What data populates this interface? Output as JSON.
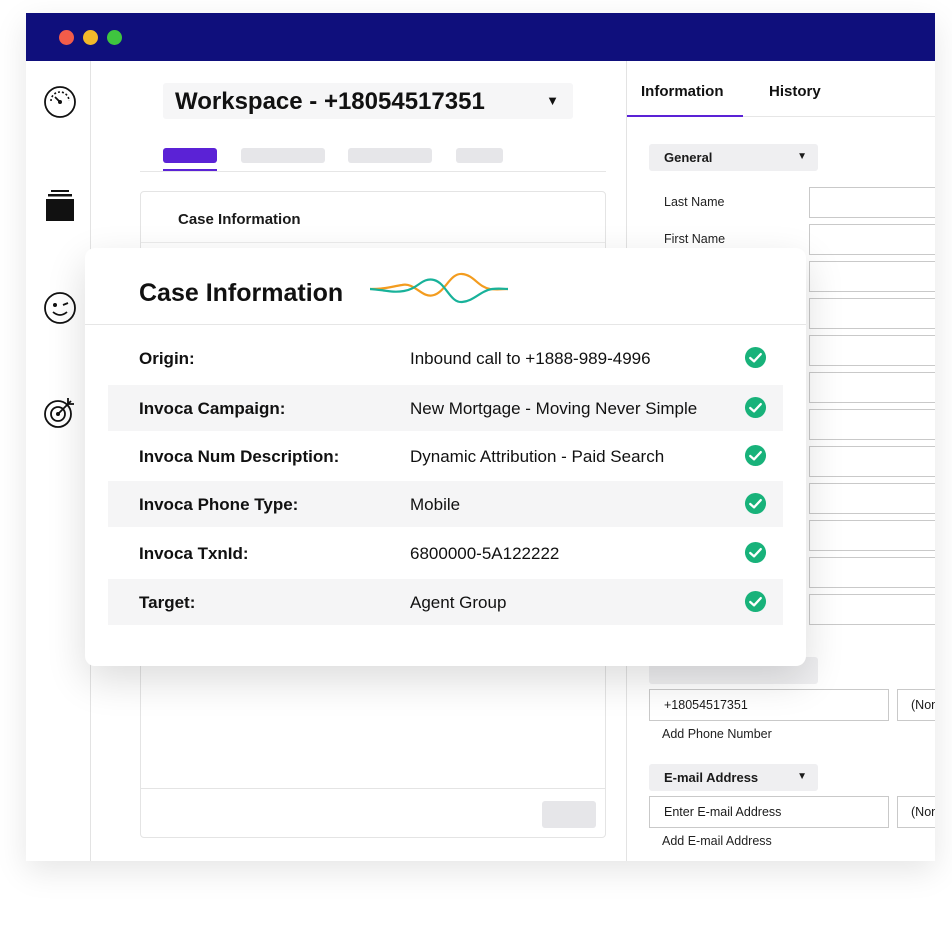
{
  "workspace": {
    "title": "Workspace - +18054517351"
  },
  "case_panel": {
    "title": "Case Information"
  },
  "right_panel": {
    "tabs": [
      "Information",
      "History"
    ],
    "general_dropdown": "General",
    "fields": [
      "Last Name",
      "First Name"
    ],
    "phone": {
      "value": "+18054517351",
      "type_value": "(Non",
      "add_label": "Add Phone Number"
    },
    "email": {
      "dropdown": "E-mail Address",
      "placeholder": "Enter E-mail Address",
      "type_value": "(Non",
      "add_label": "Add E-mail Address"
    }
  },
  "case_card": {
    "title": "Case Information",
    "rows": [
      {
        "label": "Origin:",
        "value": "Inbound call to +1888-989-4996"
      },
      {
        "label": "Invoca Campaign:",
        "value": "New Mortgage - Moving Never Simple"
      },
      {
        "label": "Invoca Num Description:",
        "value": "Dynamic Attribution - Paid Search"
      },
      {
        "label": "Invoca Phone Type:",
        "value": "Mobile"
      },
      {
        "label": "Invoca TxnId:",
        "value": "6800000-5A122222"
      },
      {
        "label": "Target:",
        "value": "Agent Group"
      }
    ]
  },
  "colors": {
    "titlebar": "#0f0f7c",
    "accent": "#5b22d6",
    "check": "#18b27a",
    "wave_orange": "#f39c1f",
    "wave_teal": "#18b29a"
  },
  "icons": [
    "dashboard-gauge-icon",
    "stack-icon",
    "wink-face-icon",
    "target-icon",
    "check-icon"
  ]
}
